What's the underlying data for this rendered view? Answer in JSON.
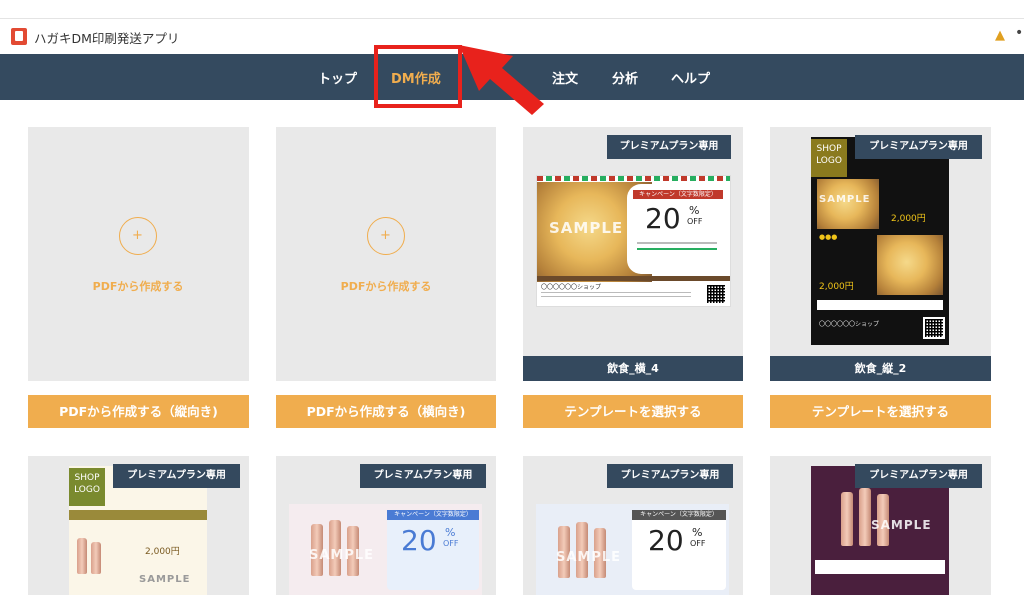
{
  "app": {
    "title": "ハガキDM印刷発送アプリ",
    "pin_icon": "pin-icon",
    "more_icon": "more-icon"
  },
  "nav": {
    "items": [
      {
        "label": "トップ"
      },
      {
        "label": "DM作成",
        "active": true
      },
      {
        "label": "注文"
      },
      {
        "label": "分析"
      },
      {
        "label": "ヘルプ"
      }
    ]
  },
  "pdf_label": "PDFから作成する",
  "premium_label": "プレミアムプラン専用",
  "cards_row1": [
    {
      "button": "PDFから作成する（縦向き)"
    },
    {
      "button": "PDFから作成する（横向き)"
    },
    {
      "caption": "飲食_横_4",
      "button": "テンプレートを選択する"
    },
    {
      "caption": "飲食_縦_2",
      "button": "テンプレートを選択する"
    }
  ],
  "dm": {
    "sample": "SAMPLE",
    "shop_logo": "SHOP LOGO",
    "campaign": "キャンペーン（文字数限定）",
    "percent": "20",
    "percent_sign": "%",
    "off": "OFF",
    "price": "2,000円",
    "shop_name": "〇〇〇〇〇〇ショップ"
  },
  "colors": {
    "nav_bg": "#344a5f",
    "accent": "#f0ad4e",
    "card_bg": "#e9e9e9",
    "highlight": "#e8221c"
  }
}
